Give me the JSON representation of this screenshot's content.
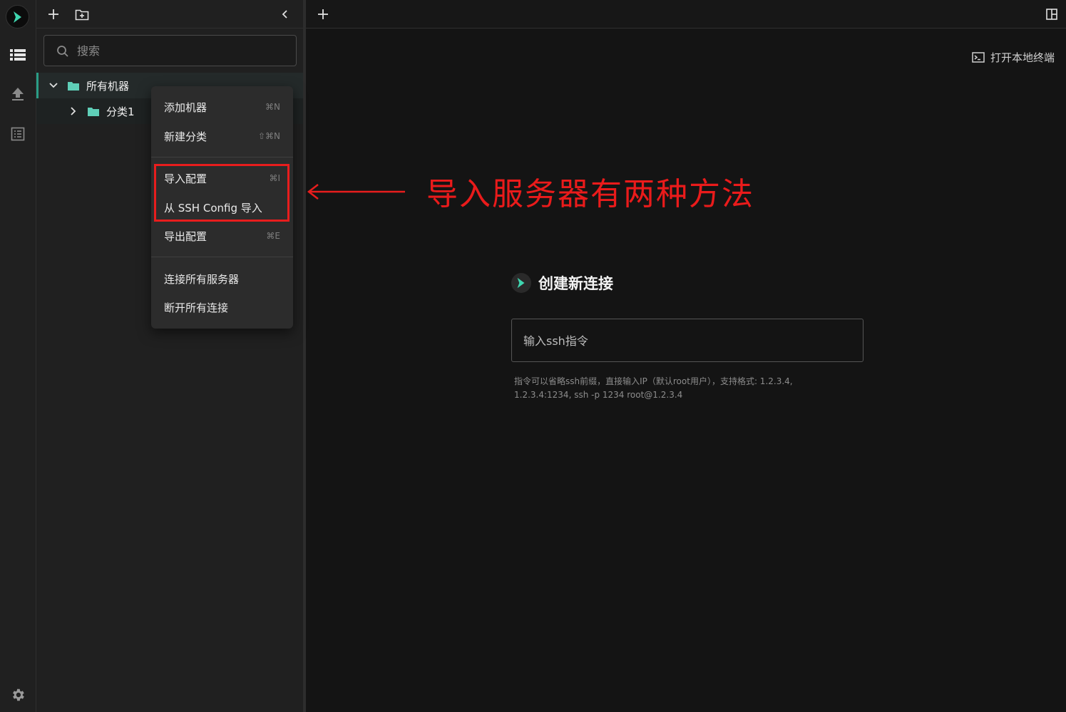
{
  "sidebar": {
    "search_placeholder": "搜索",
    "tree": {
      "root_label": "所有机器",
      "child_label": "分类1"
    }
  },
  "context_menu": {
    "items": [
      {
        "label": "添加机器",
        "shortcut": "⌘N"
      },
      {
        "label": "新建分类",
        "shortcut": "⇧⌘N"
      },
      {
        "label": "导入配置",
        "shortcut": "⌘I"
      },
      {
        "label": "从 SSH Config 导入",
        "shortcut": ""
      },
      {
        "label": "导出配置",
        "shortcut": "⌘E"
      },
      {
        "label": "连接所有服务器",
        "shortcut": ""
      },
      {
        "label": "断开所有连接",
        "shortcut": ""
      }
    ]
  },
  "annotation": {
    "text": "导入服务器有两种方法",
    "color": "#e81d1d"
  },
  "main": {
    "local_terminal_label": "打开本地终端",
    "create_title": "创建新连接",
    "ssh_placeholder": "输入ssh指令",
    "hint_line1": "指令可以省略ssh前缀，直接输入IP（默认root用户），支持格式: 1.2.3.4,",
    "hint_line2": "1.2.3.4:1234, ssh -p 1234 root@1.2.3.4"
  },
  "icons": {
    "logo": "chevron-logo-icon",
    "server_list": "list-icon",
    "upload": "upload-icon",
    "logs": "log-icon",
    "settings": "gear-icon"
  },
  "colors": {
    "accent": "#3fd6b0",
    "folder": "#5fcfb8",
    "background": "#141414",
    "sidebar": "#202020"
  }
}
